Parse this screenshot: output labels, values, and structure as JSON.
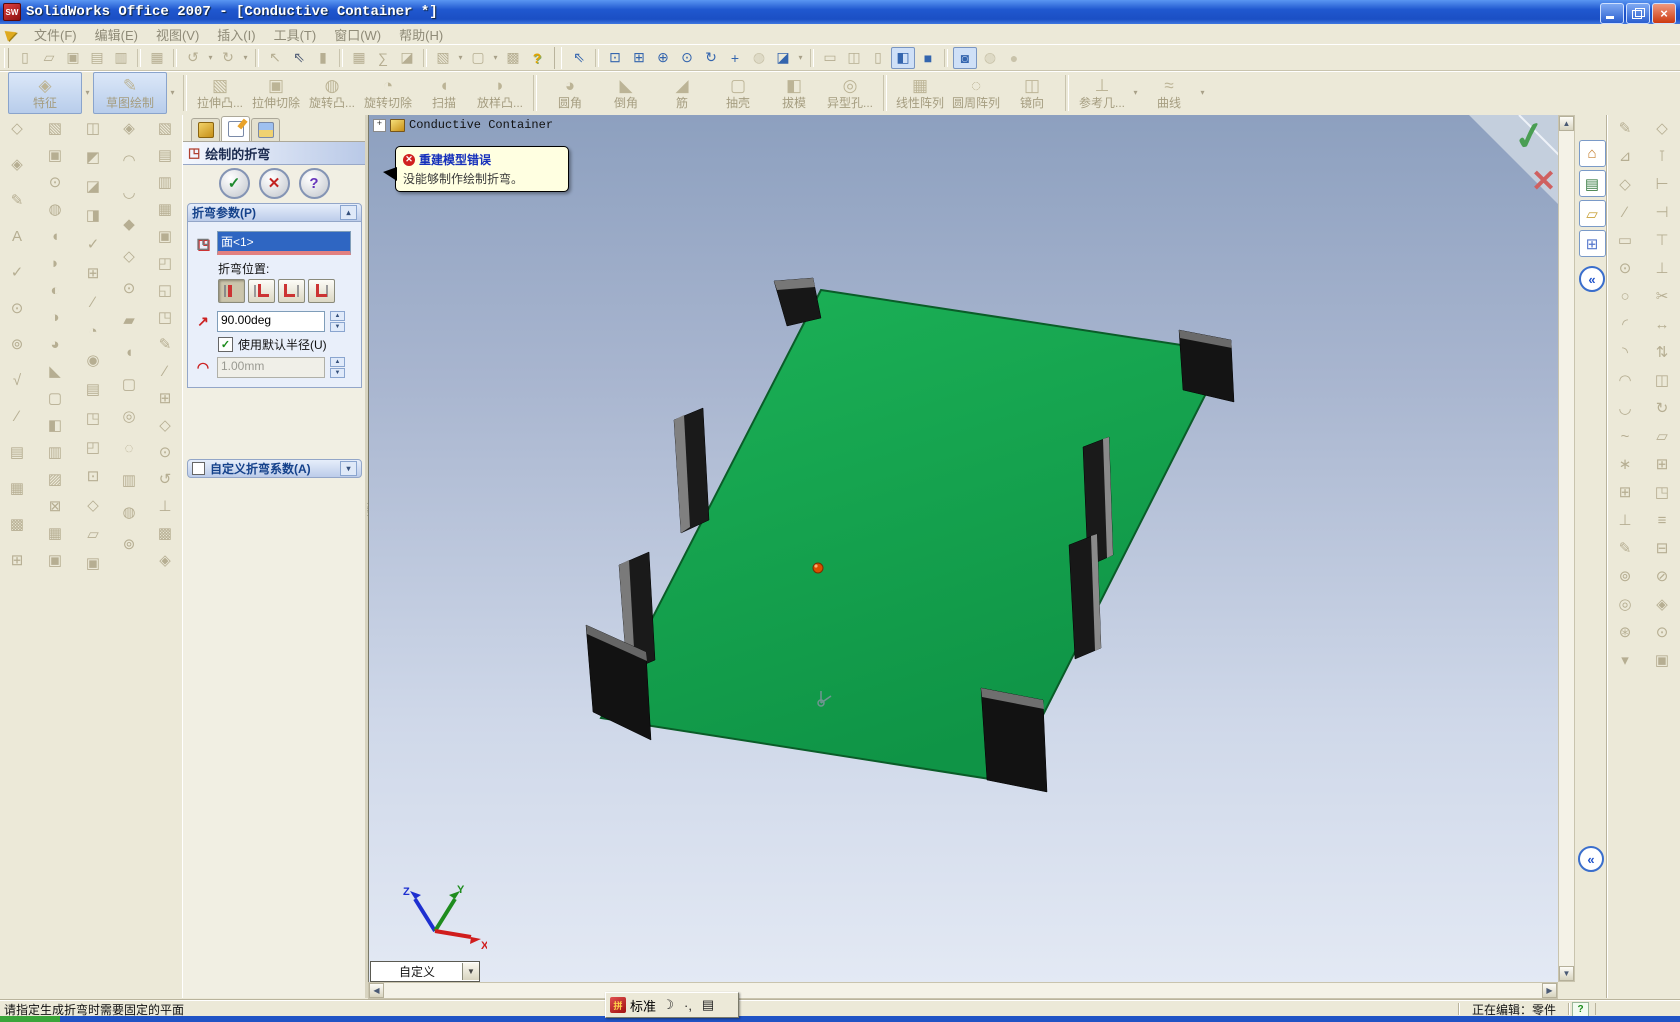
{
  "window": {
    "title": "SolidWorks Office 2007 - [Conductive Container *]"
  },
  "menu_bar": {
    "items": [
      "文件(F)",
      "编辑(E)",
      "视图(V)",
      "插入(I)",
      "工具(T)",
      "窗口(W)",
      "帮助(H)"
    ]
  },
  "toolbars": {
    "top": [
      {
        "n": "new-icon",
        "g": "▯"
      },
      {
        "n": "open-icon",
        "g": "▱"
      },
      {
        "n": "save-icon",
        "g": "▣"
      },
      {
        "n": "edit-sheet-icon",
        "g": "▤"
      },
      {
        "n": "publish-edrawing-icon",
        "g": "▥"
      },
      {
        "c": "sep"
      },
      {
        "n": "print-icon",
        "g": "▦"
      },
      {
        "c": "sep"
      },
      {
        "n": "undo-icon",
        "g": "↺"
      },
      {
        "n": "undo-dropdown-icon",
        "g": "▾",
        "c": "dd"
      },
      {
        "n": "redo-icon",
        "g": "↻"
      },
      {
        "n": "redo-dropdown-icon",
        "g": "▾",
        "c": "dd"
      },
      {
        "c": "sep"
      },
      {
        "n": "select-icon",
        "g": "↖"
      },
      {
        "n": "select-filter-icon",
        "g": "⇖",
        "c": "dark"
      },
      {
        "n": "magnetic-select-icon",
        "g": "▮"
      },
      {
        "c": "sep"
      },
      {
        "n": "grid-icon",
        "g": "▦"
      },
      {
        "n": "measure-icon",
        "g": "∑"
      },
      {
        "n": "appearance-icon",
        "g": "◪"
      },
      {
        "c": "sep"
      },
      {
        "n": "standard-views-icon",
        "g": "▧"
      },
      {
        "n": "views-dropdown-icon",
        "g": "▾",
        "c": "dd"
      },
      {
        "n": "drawing-icon",
        "g": "▢"
      },
      {
        "n": "drawing-dropdown-icon",
        "g": "▾",
        "c": "dd"
      },
      {
        "n": "options-icon",
        "g": "▩"
      },
      {
        "n": "help-icon",
        "g": "?",
        "c": "gold"
      },
      {
        "c": "sep2"
      },
      {
        "n": "smart-pick-icon",
        "g": "⇖",
        "c": "blue"
      },
      {
        "c": "sep"
      },
      {
        "n": "zoom-to-fit-icon",
        "g": "⊡",
        "c": "blue"
      },
      {
        "n": "zoom-to-area-icon",
        "g": "⊞",
        "c": "blue"
      },
      {
        "n": "zoom-in-out-icon",
        "g": "⊕",
        "c": "blue"
      },
      {
        "n": "zoom-to-selection-icon",
        "g": "⊙",
        "c": "blue"
      },
      {
        "n": "rotate-view-icon",
        "g": "↻",
        "c": "blue"
      },
      {
        "n": "pan-icon",
        "g": "+",
        "c": "blue"
      },
      {
        "n": "3d-drawing-view-icon",
        "g": "◍",
        "c": "dim"
      },
      {
        "n": "section-view-icon",
        "g": "◪",
        "c": "blue"
      },
      {
        "n": "section-dropdown-icon",
        "g": "▾",
        "c": "dd"
      },
      {
        "c": "sep"
      },
      {
        "n": "wireframe-icon",
        "g": "▭"
      },
      {
        "n": "hidden-lines-visible-icon",
        "g": "◫"
      },
      {
        "n": "hidden-lines-removed-icon",
        "g": "▯"
      },
      {
        "n": "shaded-with-edges-icon",
        "g": "◧",
        "c": "blue press"
      },
      {
        "n": "shaded-icon",
        "g": "■",
        "c": "blue"
      },
      {
        "c": "sep"
      },
      {
        "n": "shadows-icon",
        "g": "◙",
        "c": "blue press"
      },
      {
        "n": "realview-icon",
        "g": "◍",
        "c": "dim"
      },
      {
        "n": "apply-scene-icon",
        "g": "●",
        "c": "dim"
      }
    ],
    "features": [
      {
        "n": "features-toolbar-button",
        "label": "特征",
        "g": "◈",
        "c": "press"
      },
      {
        "n": "features-dropdown-icon",
        "g": "▾",
        "c": "dd"
      },
      {
        "n": "sketch-toolbar-button",
        "label": "草图绘制",
        "g": "✎",
        "c": "press"
      },
      {
        "n": "sketch-dropdown-icon",
        "g": "▾",
        "c": "dd"
      },
      {
        "c": "vsep"
      },
      {
        "n": "extruded-boss-button",
        "label": "拉伸凸...",
        "g": "▧"
      },
      {
        "n": "extruded-cut-button",
        "label": "拉伸切除",
        "g": "▣"
      },
      {
        "n": "revolved-boss-button",
        "label": "旋转凸...",
        "g": "◍"
      },
      {
        "n": "revolved-cut-button",
        "label": "旋转切除",
        "g": "◔"
      },
      {
        "n": "sweep-button",
        "label": "扫描",
        "g": "◖"
      },
      {
        "n": "lofted-boss-button",
        "label": "放样凸...",
        "g": "◗"
      },
      {
        "c": "vsep"
      },
      {
        "n": "fillet-button",
        "label": "圆角",
        "g": "◕"
      },
      {
        "n": "chamfer-button",
        "label": "倒角",
        "g": "◣"
      },
      {
        "n": "rib-button",
        "label": "筋",
        "g": "◢"
      },
      {
        "n": "shell-button",
        "label": "抽壳",
        "g": "▢"
      },
      {
        "n": "draft-button",
        "label": "拔模",
        "g": "◧"
      },
      {
        "n": "hole-wizard-button",
        "label": "异型孔...",
        "g": "◎"
      },
      {
        "c": "vsep"
      },
      {
        "n": "linear-pattern-button",
        "label": "线性阵列",
        "g": "▦"
      },
      {
        "n": "circular-pattern-button",
        "label": "圆周阵列",
        "g": "◌"
      },
      {
        "n": "mirror-button",
        "label": "镜向",
        "g": "◫"
      },
      {
        "c": "vsep"
      },
      {
        "n": "reference-geometry-button",
        "label": "参考几...",
        "g": "⊥"
      },
      {
        "n": "refgeo-dropdown-icon",
        "g": "▾",
        "c": "dd"
      },
      {
        "n": "curves-button",
        "label": "曲线",
        "g": "≈"
      },
      {
        "n": "curves-dropdown-icon",
        "g": "▾",
        "c": "dd"
      }
    ]
  },
  "left_toolbars": {
    "columns": [
      [
        "◇",
        "◈",
        "✎",
        "A",
        "✓",
        "⊙",
        "⊚",
        "√",
        "∕",
        "▤",
        "▦",
        "▩",
        "⊞"
      ],
      [
        "▧",
        "▣",
        "⊙",
        "◍",
        "◖",
        "◗",
        "◐",
        "◑",
        "◕",
        "◣",
        "▢",
        "◧",
        "▥",
        "▨",
        "⊠",
        "▦",
        "▣"
      ],
      [
        "◫",
        "◩",
        "◪",
        "◨",
        "✓",
        "⊞",
        "∕",
        "◔",
        "◉",
        "▤",
        "◳",
        "◰",
        "⊡",
        "◇",
        "▱",
        "▣"
      ],
      [
        "◈",
        "◠",
        "◡",
        "◆",
        "◇",
        "⊙",
        "▰",
        "◖",
        "▢",
        "◎",
        "◌",
        "▥",
        "◍",
        "⊚"
      ],
      [
        "▧",
        "▤",
        "▥",
        "▦",
        "▣",
        "◰",
        "◱",
        "◳",
        "✎",
        "∕",
        "⊞",
        "◇",
        "⊙",
        "↺",
        "⊥",
        "▩",
        "◈"
      ]
    ]
  },
  "property_manager": {
    "title": "绘制的折弯",
    "bend_parameters": {
      "header": "折弯参数(P)",
      "selection": "面<1>",
      "bend_position_label": "折弯位置:",
      "angle": "90.00deg",
      "use_default_radius": "使用默认半径(U)",
      "radius": "1.00mm"
    },
    "custom_bend_allowance": "自定义折弯系数(A)"
  },
  "feature_tree": {
    "expander": "+",
    "root": "Conductive Container"
  },
  "error_balloon": {
    "title": "重建模型错误",
    "message": "没能够制作绘制折弯。"
  },
  "viewport": {
    "orientation_combo": "自定义",
    "triad": {
      "x": "X",
      "y": "Y",
      "z": "Z"
    }
  },
  "right_toolbars": {
    "columns": [
      [
        "✎",
        "⊿",
        "◇",
        "∕",
        "▭",
        "⊙",
        "○",
        "◜",
        "◝",
        "◠",
        "◡",
        "~",
        "∗",
        "⊞",
        "⊥",
        "✎",
        "⊚",
        "◎",
        "⊛",
        "▾"
      ],
      [
        "◇",
        "⊺",
        "⊢",
        "⊣",
        "⊤",
        "⊥",
        "✂",
        "↔",
        "⇅",
        "◫",
        "↻",
        "▱",
        "⊞",
        "◳",
        "≡",
        "⊟",
        "⊘",
        "◈",
        "⊙",
        "▣"
      ]
    ]
  },
  "task_pane": {
    "tabs": [
      {
        "n": "solidworks-resources-tab",
        "g": "⌂",
        "c": "gold"
      },
      {
        "n": "design-library-tab",
        "g": "▤",
        "c": "multi"
      },
      {
        "n": "file-explorer-tab",
        "g": "▱",
        "c": "tan"
      },
      {
        "n": "view-palette-tab",
        "g": "⊞",
        "c": "blue"
      }
    ]
  },
  "status_bar": {
    "message": "请指定生成折弯时需要固定的平面",
    "edit_mode": "正在编辑：零件",
    "help": "?"
  },
  "ime_bar": {
    "name": "标准"
  },
  "colors": {
    "model_green": "#17a04d",
    "model_edge": "#0a5c28",
    "flange_dark": "#171717",
    "selection_blue": "#2f66c2",
    "viewport_top": "#8da0bf",
    "viewport_bottom": "#e3e9f4",
    "error_red": "#d02020"
  }
}
